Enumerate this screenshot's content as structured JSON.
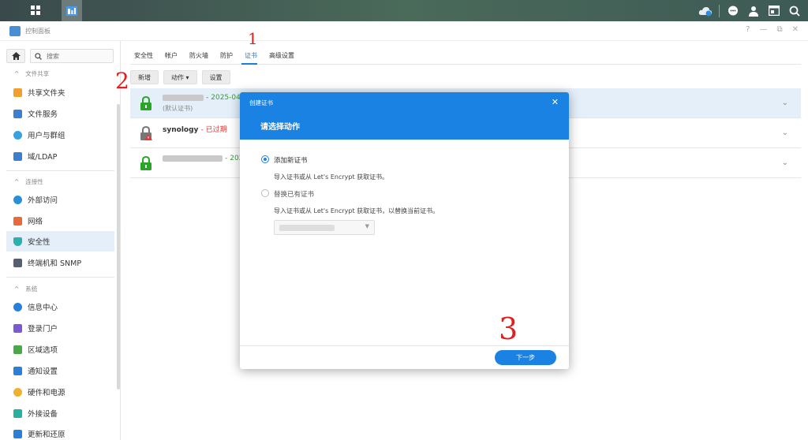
{
  "window": {
    "title": "控制面板"
  },
  "sidebar": {
    "search_placeholder": "搜索",
    "sections": [
      "文件共享",
      "连接性",
      "系统"
    ],
    "items": [
      {
        "label": "共享文件夹",
        "color": "#f0a030"
      },
      {
        "label": "文件服务",
        "color": "#3a7fd0"
      },
      {
        "label": "用户与群组",
        "color": "#3aa0e0"
      },
      {
        "label": "域/LDAP",
        "color": "#3a7fd0"
      },
      {
        "label": "外部访问",
        "color": "#2a8fd8"
      },
      {
        "label": "网络",
        "color": "#e86a3a"
      },
      {
        "label": "安全性",
        "color": "#2ab0b0"
      },
      {
        "label": "终端机和 SNMP",
        "color": "#555f70"
      },
      {
        "label": "信息中心",
        "color": "#2a7fd8"
      },
      {
        "label": "登录门户",
        "color": "#7a5ad0"
      },
      {
        "label": "区域选项",
        "color": "#4aa84a"
      },
      {
        "label": "通知设置",
        "color": "#2a7fd8"
      },
      {
        "label": "硬件和电源",
        "color": "#f0b030"
      },
      {
        "label": "外接设备",
        "color": "#2ab0a0"
      },
      {
        "label": "更新和还原",
        "color": "#2a7fd8"
      }
    ]
  },
  "tabs": [
    "安全性",
    "帐户",
    "防火墙",
    "防护",
    "证书",
    "高级设置"
  ],
  "toolbar": {
    "add": "新增",
    "action": "动作 ▾",
    "settings": "设置"
  },
  "certs": [
    {
      "date": "- 2025-04",
      "sub": "(默认证书)"
    },
    {
      "name": "synology",
      "status": "- 已过期"
    },
    {
      "date": "- 202"
    }
  ],
  "modal": {
    "title": "创建证书",
    "heading": "请选择动作",
    "option1_label": "添加新证书",
    "option1_desc": "导入证书或从 Let's Encrypt 获取证书。",
    "option2_label": "替换已有证书",
    "option2_desc": "导入证书或从 Let's Encrypt 获取证书，以替换当前证书。",
    "next": "下一步"
  },
  "annotations": [
    "1",
    "2",
    "3"
  ],
  "colors": {
    "accent": "#1a82e2",
    "active_bg": "#e4eff9"
  }
}
